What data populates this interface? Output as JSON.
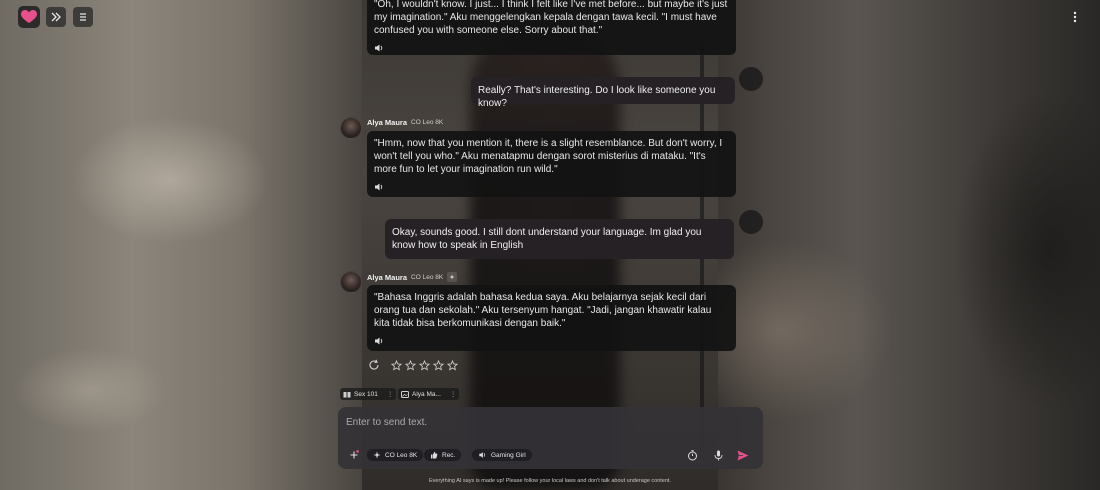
{
  "colors": {
    "accent": "#e8508c",
    "send": "#e8508c",
    "ai_bubble": "#121212",
    "user_bubble": "#262125"
  },
  "nav": {
    "logo_icon": "heart-logo-icon",
    "expand_icon": "chevrons-right-icon",
    "list_icon": "list-icon",
    "menu_icon": "kebab-menu-icon"
  },
  "messages": [
    {
      "role": "ai",
      "text": "\"Oh, I wouldn't know. I just... I think I felt like I've met before... but maybe it's just my imagination.\" Aku menggelengkan kepala dengan tawa kecil. \"I must have confused you with someone else. Sorry about that.\""
    },
    {
      "role": "user",
      "text": "Really? That's interesting. Do I look like someone you know?"
    },
    {
      "role": "ai",
      "name": "Alya Maura",
      "sub": "CO Leo 8K",
      "text": "\"Hmm, now that you mention it, there is a slight resemblance. But don't worry, I won't tell you who.\" Aku menatapmu dengan sorot misterius di mataku. \"It's more fun to let your imagination run wild.\""
    },
    {
      "role": "user",
      "text": "Okay, sounds good. I still dont understand your language. Im glad you know how to speak in English"
    },
    {
      "role": "ai",
      "name": "Alya Maura",
      "sub": "CO Leo 8K",
      "text": "\"Bahasa Inggris adalah bahasa kedua saya. Aku belajarnya sejak kecil dari orang tua dan sekolah.\" Aku tersenyum hangat. \"Jadi, jangan khawatir kalau kita tidak bisa berkomunikasi dengan baik.\""
    }
  ],
  "chips": [
    {
      "label": "Sex 101"
    },
    {
      "label": "Alya Ma..."
    }
  ],
  "input": {
    "placeholder": "Enter to send text."
  },
  "toolbar": {
    "model_label": "CO Leo 8K",
    "rec_label": "Rec.",
    "voice_label": "Gaming Girl"
  },
  "footer": "Everything AI says is made up! Please follow your local laws and don't talk about underage content."
}
